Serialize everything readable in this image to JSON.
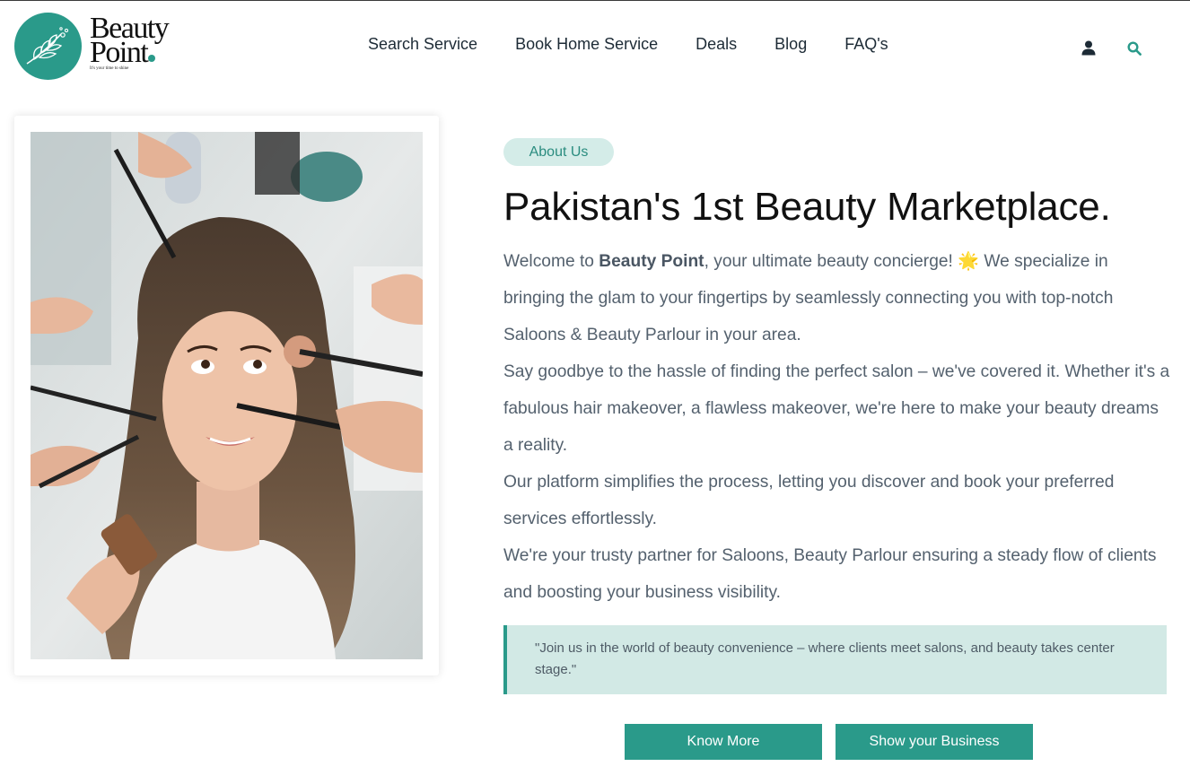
{
  "brand": {
    "name_line1": "Beauty",
    "name_line2": "Point",
    "tagline": "It's your time to shine",
    "accent_color": "#2a9a8a",
    "badge_bg_color": "#d4ece8",
    "quote_bg_color": "#d2e9e5"
  },
  "nav": {
    "items": [
      {
        "label": "Search Service"
      },
      {
        "label": "Book Home Service"
      },
      {
        "label": "Deals"
      },
      {
        "label": "Blog"
      },
      {
        "label": "FAQ's"
      }
    ],
    "user_icon": "user-icon",
    "search_icon": "search-icon"
  },
  "hero_image": {
    "description_icon": "woman-makeover-photo"
  },
  "about": {
    "badge": "About Us",
    "headline": "Pakistan's 1st Beauty Marketplace.",
    "p1_before": "Welcome to ",
    "p1_bold": "Beauty Point",
    "p1_after": ", your ultimate beauty concierge! 🌟 We specialize in bringing the glam to your fingertips by seamlessly connecting you with top-notch Saloons & Beauty Parlour in your area.",
    "p2": "Say goodbye to the hassle of finding the perfect salon – we've covered it. Whether it's a fabulous hair makeover, a flawless makeover, we're here to make your beauty dreams a reality.",
    "p3": "Our platform simplifies the process, letting you discover and book your preferred services effortlessly.",
    "p4": "We're your trusty partner for Saloons, Beauty Parlour ensuring a steady flow of clients and boosting your business visibility.",
    "quote": "\"Join us in the world of beauty convenience – where clients meet salons, and beauty takes center stage.\""
  },
  "buttons": {
    "know_more": "Know More",
    "show_business": "Show your Business"
  }
}
